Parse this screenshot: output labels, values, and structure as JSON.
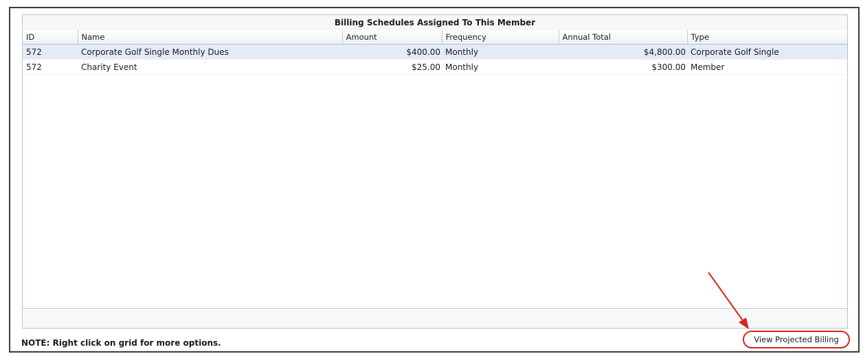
{
  "panel": {
    "title": "Billing Schedules Assigned To This Member"
  },
  "grid": {
    "columns": [
      "ID",
      "Name",
      "Amount",
      "Frequency",
      "Annual Total",
      "Type"
    ],
    "rows": [
      {
        "id": "572",
        "name": "Corporate Golf Single Monthly Dues",
        "amount": "$400.00",
        "frequency": "Monthly",
        "annual_total": "$4,800.00",
        "type": "Corporate Golf Single"
      },
      {
        "id": "572",
        "name": "Charity Event",
        "amount": "$25.00",
        "frequency": "Monthly",
        "annual_total": "$300.00",
        "type": "Member"
      }
    ]
  },
  "note": "NOTE: Right click on grid for more options.",
  "button": {
    "view_projected_billing": "View Projected Billing"
  },
  "colors": {
    "annotation": "#d9261c",
    "selected_row": "#e3ebf7"
  }
}
